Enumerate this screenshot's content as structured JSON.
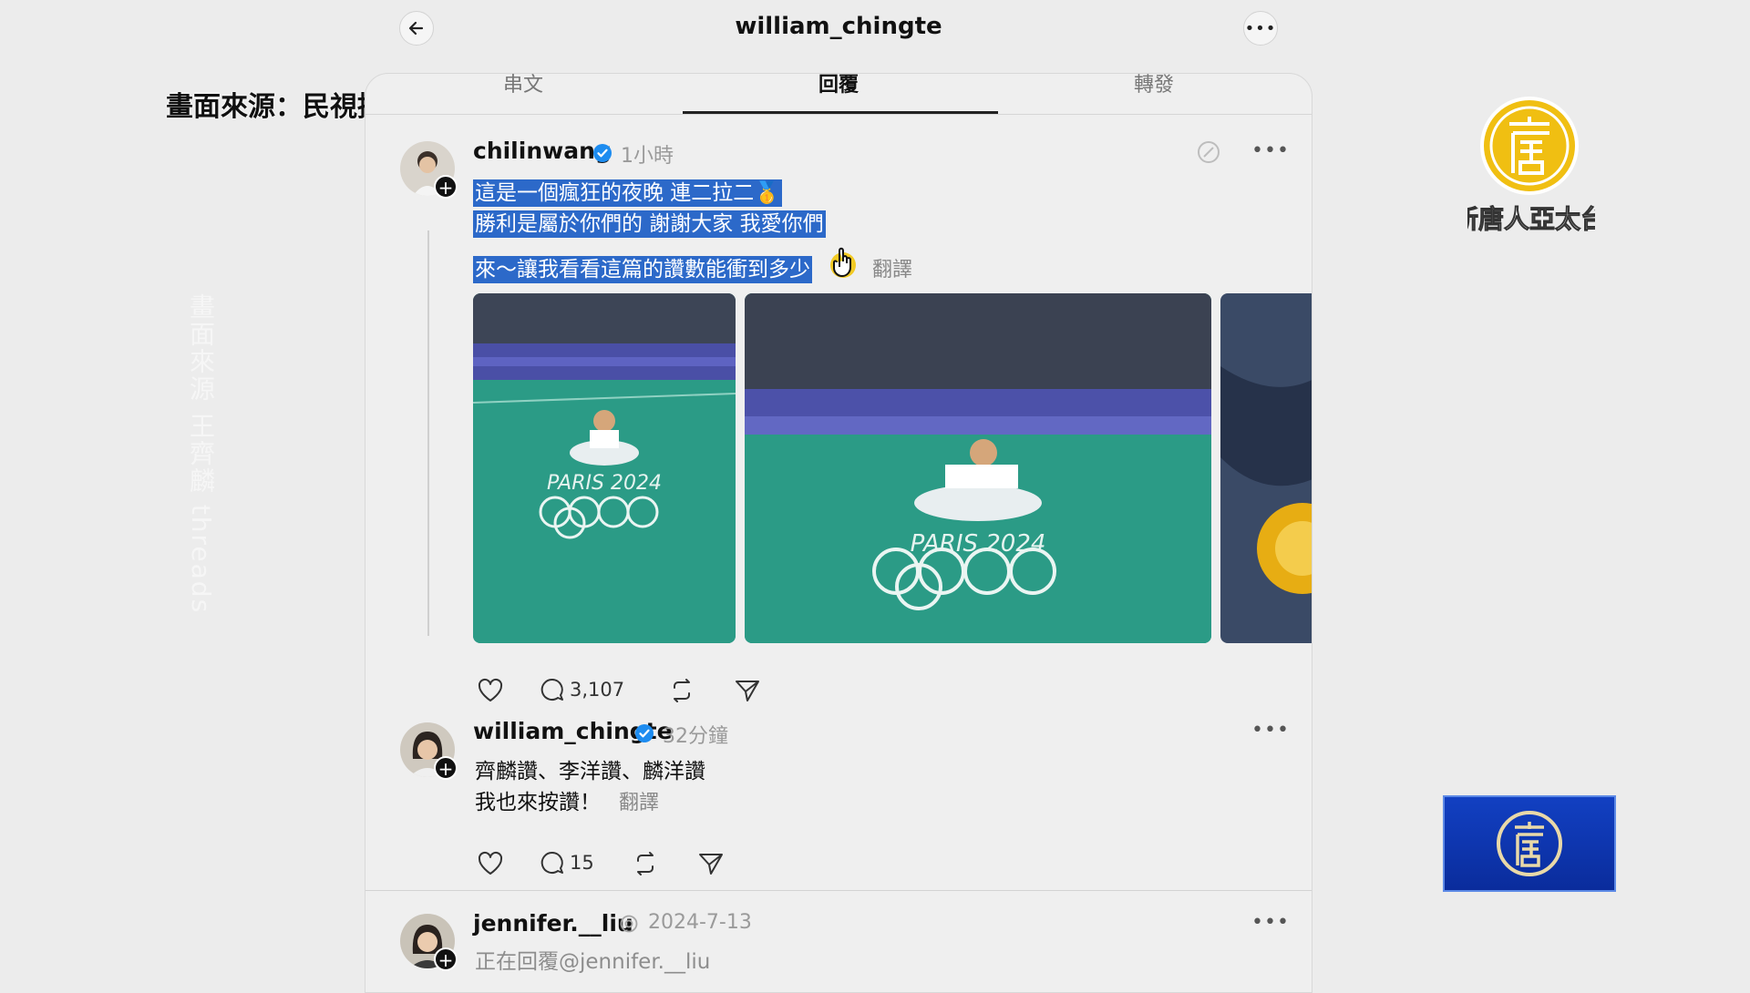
{
  "header": {
    "title": "william_chingte",
    "back_icon": "arrow-left-icon",
    "more_icon": "more-horizontal-icon"
  },
  "overlay": {
    "source_label": "畫面來源：民視提供",
    "vertical_watermark": "畫面來源 王齊麟 threads",
    "logo_text": "新唐人亞太台"
  },
  "tabs": [
    {
      "label": "串文"
    },
    {
      "label": "回覆",
      "active": true
    },
    {
      "label": "轉發"
    }
  ],
  "posts": [
    {
      "username": "chilinwang",
      "verified": true,
      "time": "1小時",
      "lines": [
        "這是一個瘋狂的夜晚 連二拉二🥇",
        "勝利是屬於你們的 謝謝大家 我愛你們",
        "",
        "來～讓我看看這篇的讚數能衝到多少"
      ],
      "selected_text": true,
      "translate": "翻譯",
      "comment_count": "3,107",
      "photos": [
        "paris-2024-court-photo-1",
        "paris-2024-court-photo-2",
        "gold-medal-photo"
      ]
    },
    {
      "username": "william_chingte",
      "verified": true,
      "time": "32分鐘",
      "lines": [
        "齊麟讚、李洋讚、麟洋讚",
        "我也來按讚！"
      ],
      "translate": "翻譯",
      "comment_count": "15"
    },
    {
      "username": "jennifer.__liu",
      "time": "2024-7-13",
      "reply_to": "正在回覆@jennifer.__liu"
    }
  ],
  "photo_text": {
    "court_brand": "PARIS 2024"
  },
  "colors": {
    "highlight": "#2c69c9",
    "verified": "#1d8cf0",
    "court_green": "#2a9a83",
    "logo_gold": "#e7ad13",
    "logo_blue": "#1240c2"
  }
}
